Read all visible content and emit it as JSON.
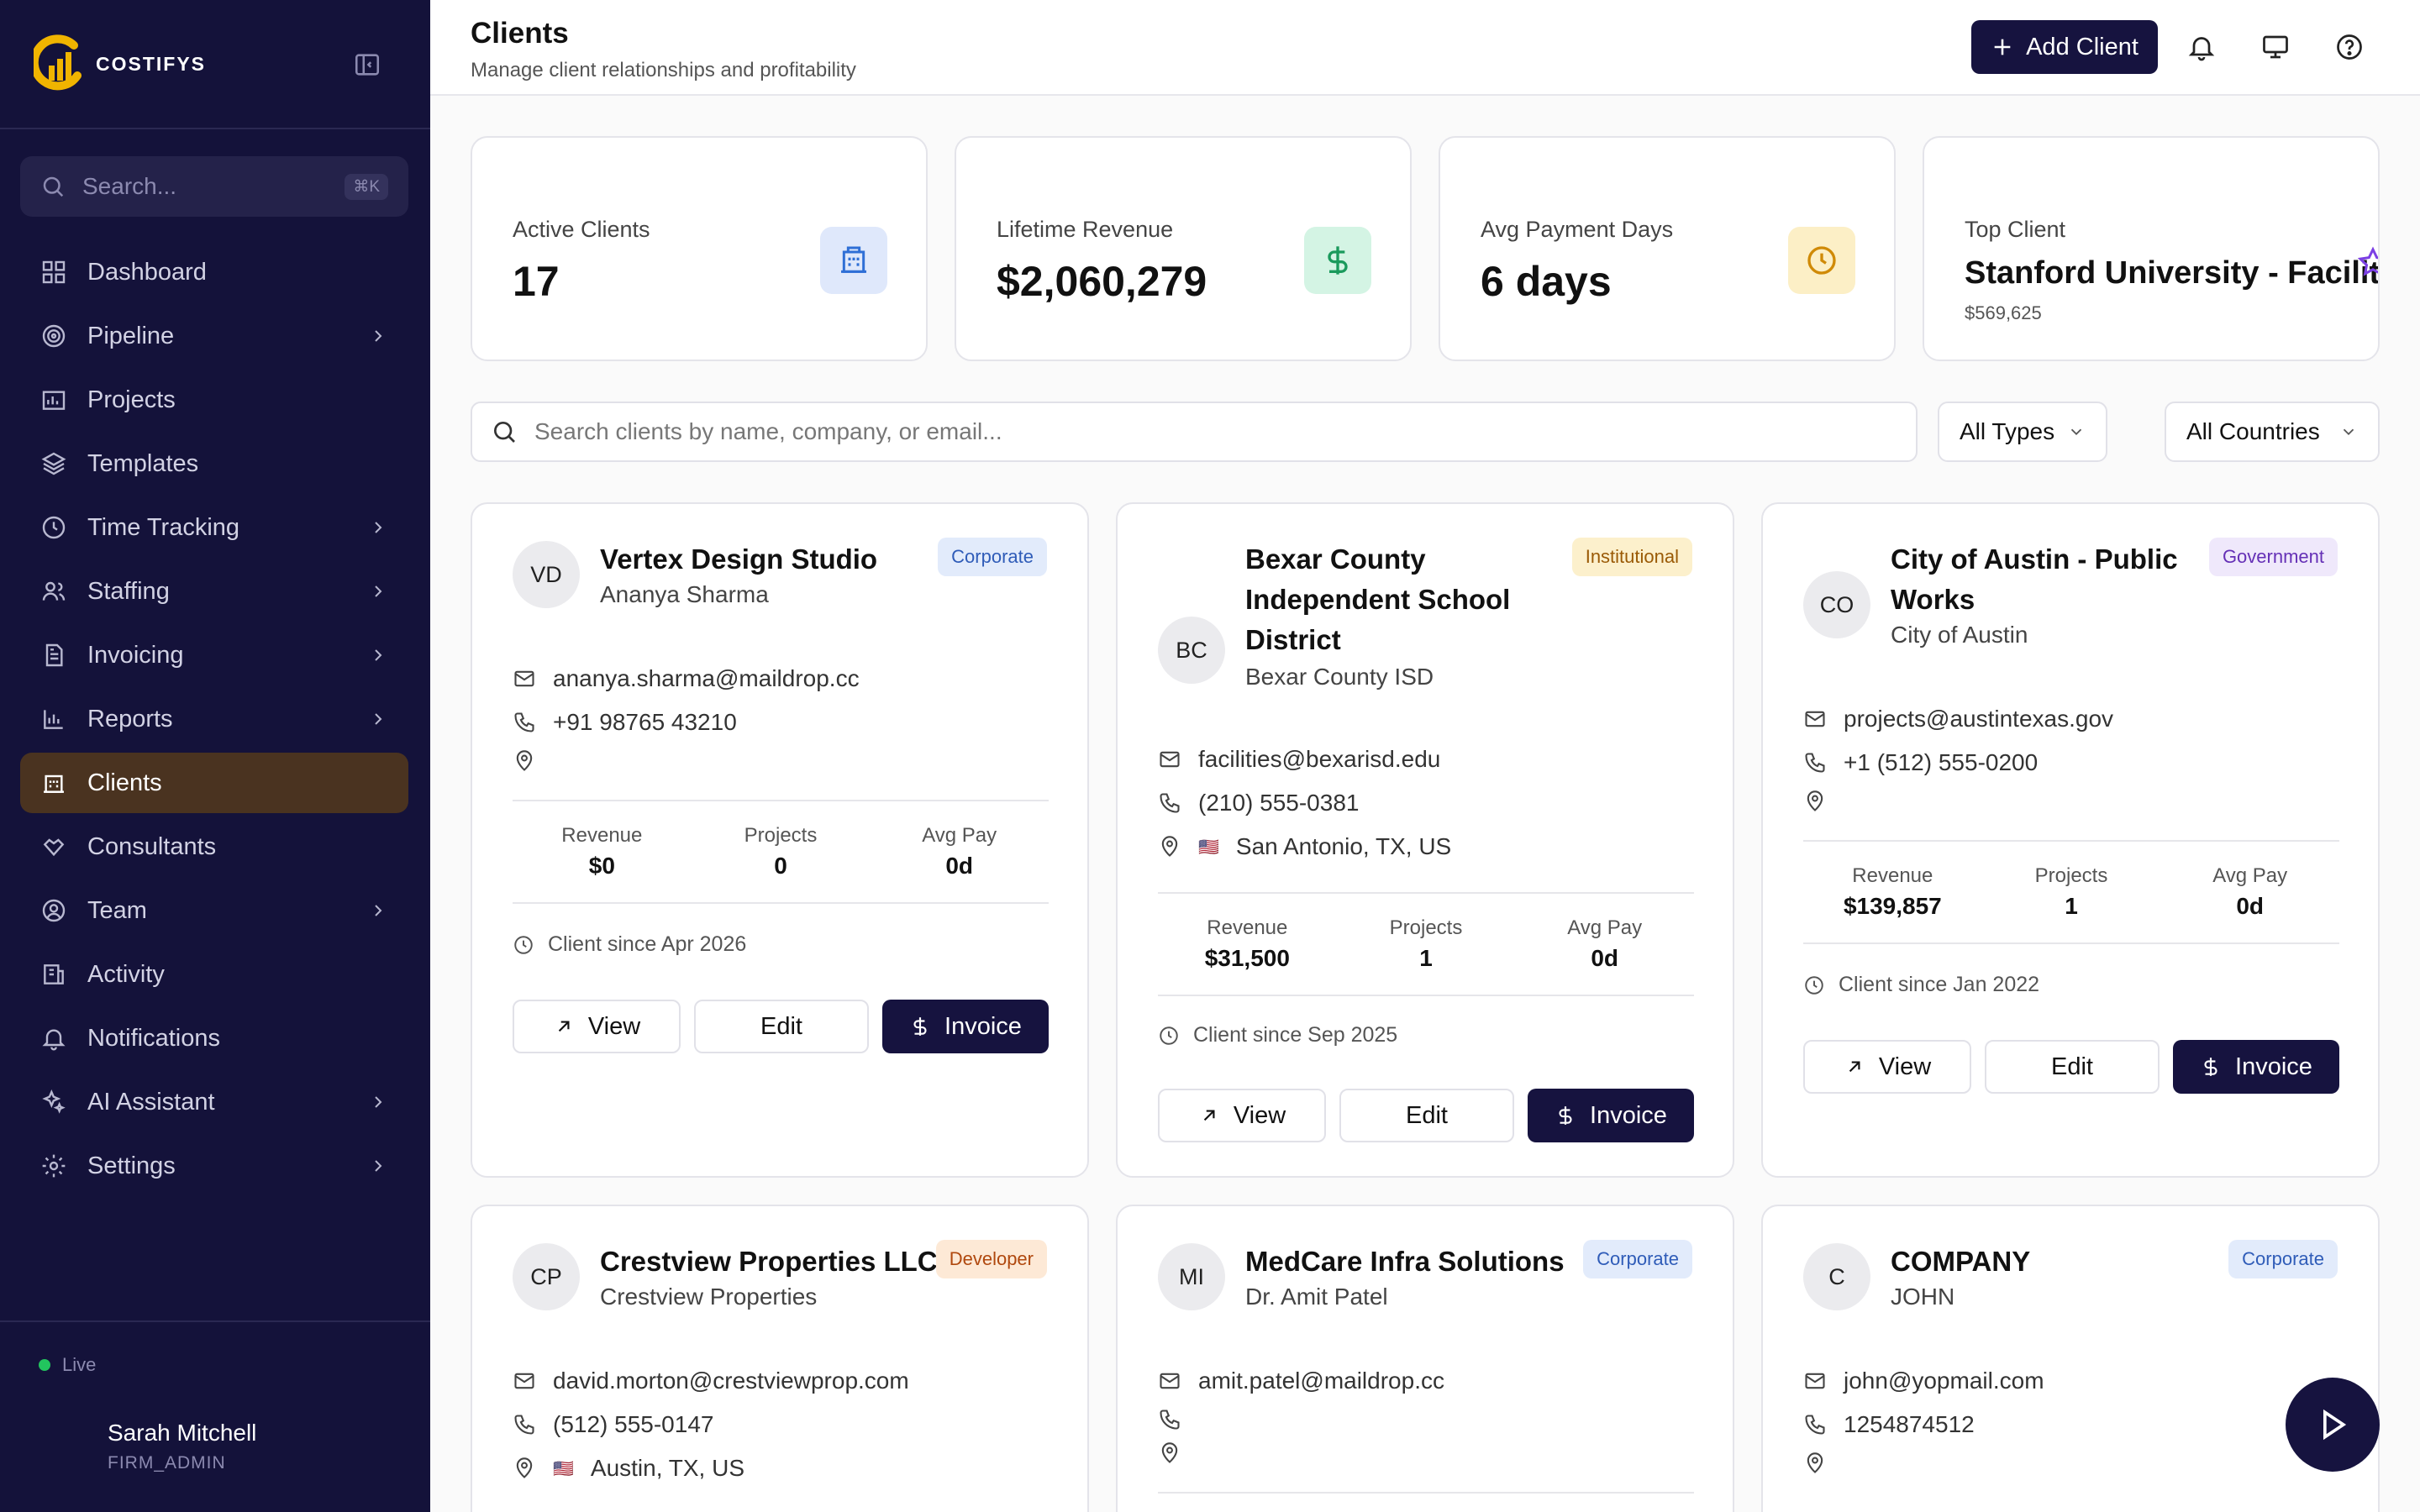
{
  "brand": {
    "name": "COSTIFYS"
  },
  "sidebar": {
    "search_placeholder": "Search...",
    "search_shortcut": "⌘K",
    "items": [
      {
        "label": "Dashboard",
        "icon": "dashboard-icon",
        "has_chevron": false,
        "active": false
      },
      {
        "label": "Pipeline",
        "icon": "pipeline-icon",
        "has_chevron": true,
        "active": false
      },
      {
        "label": "Projects",
        "icon": "projects-icon",
        "has_chevron": false,
        "active": false
      },
      {
        "label": "Templates",
        "icon": "templates-icon",
        "has_chevron": false,
        "active": false
      },
      {
        "label": "Time Tracking",
        "icon": "clock-icon",
        "has_chevron": true,
        "active": false
      },
      {
        "label": "Staffing",
        "icon": "staffing-icon",
        "has_chevron": true,
        "active": false
      },
      {
        "label": "Invoicing",
        "icon": "invoice-icon",
        "has_chevron": true,
        "active": false
      },
      {
        "label": "Reports",
        "icon": "reports-icon",
        "has_chevron": true,
        "active": false
      },
      {
        "label": "Clients",
        "icon": "clients-icon",
        "has_chevron": false,
        "active": true
      },
      {
        "label": "Consultants",
        "icon": "consultants-icon",
        "has_chevron": false,
        "active": false
      },
      {
        "label": "Team",
        "icon": "team-icon",
        "has_chevron": true,
        "active": false
      },
      {
        "label": "Activity",
        "icon": "activity-icon",
        "has_chevron": false,
        "active": false
      },
      {
        "label": "Notifications",
        "icon": "bell-icon",
        "has_chevron": false,
        "active": false
      },
      {
        "label": "AI Assistant",
        "icon": "sparkles-icon",
        "has_chevron": true,
        "active": false
      },
      {
        "label": "Settings",
        "icon": "gear-icon",
        "has_chevron": true,
        "active": false
      }
    ],
    "status": "Live",
    "user": {
      "name": "Sarah Mitchell",
      "role": "FIRM_ADMIN"
    }
  },
  "header": {
    "title": "Clients",
    "subtitle": "Manage client relationships and profitability",
    "add_button": "Add Client"
  },
  "stats": {
    "active_clients": {
      "label": "Active Clients",
      "value": "17"
    },
    "lifetime_revenue": {
      "label": "Lifetime Revenue",
      "value": "$2,060,279"
    },
    "avg_payment": {
      "label": "Avg Payment Days",
      "value": "6 days"
    },
    "top_client": {
      "label": "Top Client",
      "value": "Stanford University - Facilities",
      "sub": "$569,625"
    }
  },
  "filters": {
    "search_placeholder": "Search clients by name, company, or email...",
    "type": "All Types",
    "country": "All Countries"
  },
  "labels": {
    "revenue": "Revenue",
    "projects": "Projects",
    "avg_pay": "Avg Pay",
    "view": "View",
    "edit": "Edit",
    "invoice": "Invoice"
  },
  "clients": [
    {
      "initials": "VD",
      "name": "Vertex Design Studio",
      "contact": "Ananya Sharma",
      "type": "Corporate",
      "email": "ananya.sharma@maildrop.cc",
      "phone": "+91 98765 43210",
      "location": "",
      "flag": "",
      "revenue": "$0",
      "projects": "0",
      "avg_pay": "0d",
      "since": "Client since Apr 2026"
    },
    {
      "initials": "BC",
      "name": "Bexar County Independent School District",
      "contact": "Bexar County ISD",
      "type": "Institutional",
      "email": "facilities@bexarisd.edu",
      "phone": "(210) 555-0381",
      "location": "San Antonio, TX, US",
      "flag": "🇺🇸",
      "revenue": "$31,500",
      "projects": "1",
      "avg_pay": "0d",
      "since": "Client since Sep 2025"
    },
    {
      "initials": "CO",
      "name": "City of Austin - Public Works",
      "contact": "City of Austin",
      "type": "Government",
      "email": "projects@austintexas.gov",
      "phone": "+1 (512) 555-0200",
      "location": "",
      "flag": "",
      "revenue": "$139,857",
      "projects": "1",
      "avg_pay": "0d",
      "since": "Client since Jan 2022"
    },
    {
      "initials": "CP",
      "name": "Crestview Properties LLC",
      "contact": "Crestview Properties",
      "type": "Developer",
      "email": "david.morton@crestviewprop.com",
      "phone": "(512) 555-0147",
      "location": "Austin, TX, US",
      "flag": "🇺🇸"
    },
    {
      "initials": "MI",
      "name": "MedCare Infra Solutions",
      "contact": "Dr. Amit Patel",
      "type": "Corporate",
      "email": "amit.patel@maildrop.cc",
      "phone": "",
      "location": "",
      "flag": ""
    },
    {
      "initials": "C",
      "name": "COMPANY",
      "contact": "JOHN",
      "type": "Corporate",
      "email": "john@yopmail.com",
      "phone": "1254874512",
      "location": "",
      "flag": ""
    }
  ]
}
